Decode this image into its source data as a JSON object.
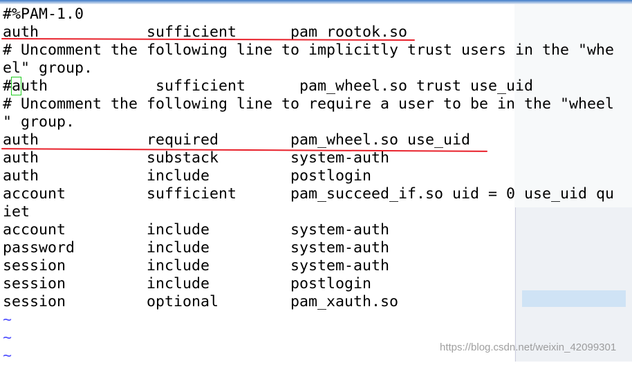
{
  "lines": [
    "#%PAM-1.0",
    "auth            sufficient      pam_rootok.so",
    "# Uncomment the following line to implicitly trust users in the \"whe",
    "el\" group.",
    "auth            sufficient      pam_wheel.so trust use_uid",
    "# Uncomment the following line to require a user to be in the \"wheel",
    "\" group.",
    "auth            required        pam_wheel.so use_uid",
    "auth            substack        system-auth",
    "auth            include         postlogin",
    "account         sufficient      pam_succeed_if.so uid = 0 use_uid qu",
    "iet",
    "account         include         system-auth",
    "password        include         system-auth",
    "session         include         system-auth",
    "session         include         postlogin",
    "session         optional        pam_xauth.so"
  ],
  "cursor_line": {
    "prefix": "#",
    "char": "a",
    "rest": "uth            sufficient      pam_wheel.so trust use_uid"
  },
  "empty_marker": "~",
  "watermark": "https://blog.csdn.net/weixin_42099301",
  "colors": {
    "underline": "#e8202a",
    "cursor": "#22cc22",
    "tilde": "#5050ff"
  }
}
